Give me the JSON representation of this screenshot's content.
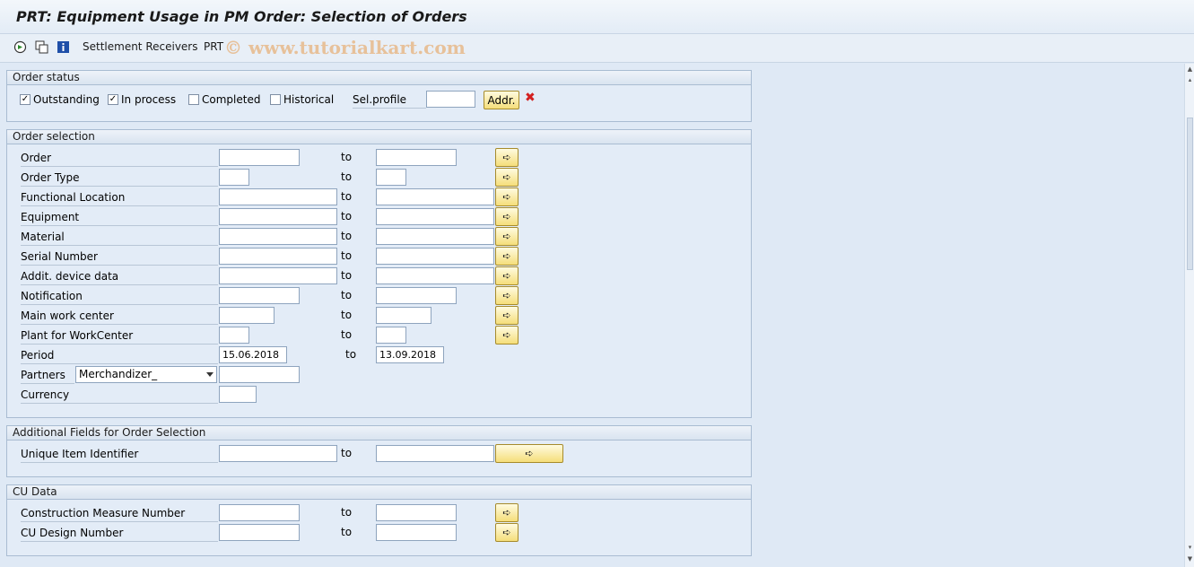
{
  "window": {
    "title": "PRT: Equipment Usage in PM Order: Selection of Orders"
  },
  "toolbar": {
    "icons": [
      "execute-icon",
      "copy-icon",
      "info-icon"
    ],
    "settlement_label": "Settlement Receivers",
    "prt_label": "PRT",
    "watermark": "© www.tutorialkart.com"
  },
  "order_status": {
    "title": "Order status",
    "checkboxes": [
      {
        "label": "Outstanding",
        "checked": true
      },
      {
        "label": "In process",
        "checked": true
      },
      {
        "label": "Completed",
        "checked": false
      },
      {
        "label": "Historical",
        "checked": false
      }
    ],
    "sel_profile_label": "Sel.profile",
    "sel_profile_value": "",
    "addr_button": "Addr.",
    "delete_icon": "delete-icon"
  },
  "order_selection": {
    "title": "Order selection",
    "to_label": "to",
    "rows": [
      {
        "label": "Order",
        "from": "",
        "to": ""
      },
      {
        "label": "Order Type",
        "from": "",
        "to": ""
      },
      {
        "label": "Functional Location",
        "from": "",
        "to": ""
      },
      {
        "label": "Equipment",
        "from": "",
        "to": ""
      },
      {
        "label": "Material",
        "from": "",
        "to": ""
      },
      {
        "label": "Serial Number",
        "from": "",
        "to": ""
      },
      {
        "label": "Addit. device data",
        "from": "",
        "to": ""
      },
      {
        "label": "Notification",
        "from": "",
        "to": ""
      },
      {
        "label": "Main work center",
        "from": "",
        "to": ""
      },
      {
        "label": "Plant for WorkCenter",
        "from": "",
        "to": ""
      },
      {
        "label": "Period",
        "from": "15.06.2018",
        "to": "13.09.2018"
      }
    ],
    "partners_label": "Partners",
    "partners_value": "Merchandizer_",
    "partners_field": "",
    "currency_label": "Currency",
    "currency_value": ""
  },
  "additional_fields": {
    "title": "Additional Fields for Order Selection",
    "to_label": "to",
    "rows": [
      {
        "label": "Unique Item Identifier",
        "from": "",
        "to": ""
      }
    ]
  },
  "cu_data": {
    "title": "CU Data",
    "to_label": "to",
    "rows": [
      {
        "label": "Construction Measure Number",
        "from": "",
        "to": ""
      },
      {
        "label": "CU Design Number",
        "from": "",
        "to": ""
      }
    ]
  },
  "colors": {
    "background": "#dfe9f5",
    "button_yellow": "#f5de7a",
    "accent_red": "#d32020"
  }
}
